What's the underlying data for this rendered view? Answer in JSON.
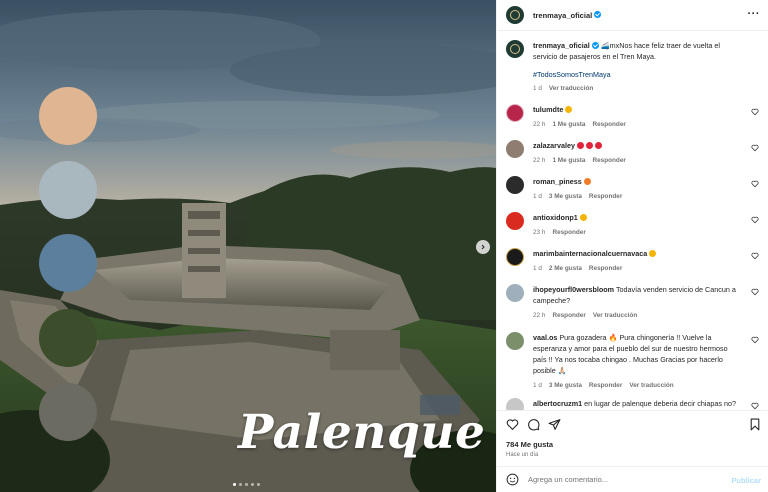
{
  "media": {
    "title": "Palenque",
    "palette": [
      "#e0b592",
      "#a9b7bf",
      "#5b7f9c",
      "#3b4d2a",
      "#6b6b62"
    ]
  },
  "header": {
    "username": "trenmaya_oficial"
  },
  "caption": {
    "username": "trenmaya_oficial",
    "text": "🚄‍mxNos hace feliz traer de vuelta el servicio de pasajeros en el Tren Maya.",
    "hashtag": "#TodosSomosTrenMaya",
    "time": "1 d",
    "translate": "Ver traducción"
  },
  "comments": [
    {
      "username": "tulumdte",
      "text": "",
      "time": "22 h",
      "likes": "1 Me gusta",
      "reply": "Responder",
      "emoji": "#f5b400"
    },
    {
      "username": "zalazarvaley",
      "text": "",
      "time": "22 h",
      "likes": "1 Me gusta",
      "reply": "Responder",
      "emoji": "#e0243b"
    },
    {
      "username": "roman_piness",
      "text": "",
      "time": "1 d",
      "likes": "3 Me gusta",
      "reply": "Responder",
      "emoji": "#f07c2a"
    },
    {
      "username": "antioxidonp1",
      "text": "",
      "time": "23 h",
      "likes": "",
      "reply": "Responder",
      "emoji": "#f5b400"
    },
    {
      "username": "marimbainternacionalcuernavaca",
      "text": "",
      "time": "1 d",
      "likes": "2 Me gusta",
      "reply": "Responder",
      "emoji": "#f5b400"
    },
    {
      "username": "ihopeyourfl0wersbloom",
      "text": "Todavía venden servicio de Cancun a campeche?",
      "time": "22 h",
      "likes": "",
      "reply": "Responder",
      "translate": "Ver traducción"
    },
    {
      "username": "vaal.os",
      "text": "Pura gozadera 🔥 Pura chingonería !! Vuelve la esperanza y amor para el pueblo del sur de nuestro hermoso país !! Ya nos tocaba chingao . Muchas Gracias por hacerlo posible 🙏🏼",
      "time": "1 d",
      "likes": "3 Me gusta",
      "reply": "Responder",
      "translate": "Ver traducción"
    },
    {
      "username": "albertocruzm1",
      "text": "en lugar de palenque deberia decir chiapas no?",
      "time": "",
      "likes": "",
      "reply": ""
    }
  ],
  "actions": {
    "likes": "784 Me gusta",
    "when": "Hace un día"
  },
  "add_comment": {
    "placeholder": "Agrega un comentario...",
    "post_label": "Publicar"
  },
  "colors": {
    "accent": "#0095f6",
    "link": "#00376b",
    "muted": "#737373",
    "heart_red": "#e0243b"
  }
}
